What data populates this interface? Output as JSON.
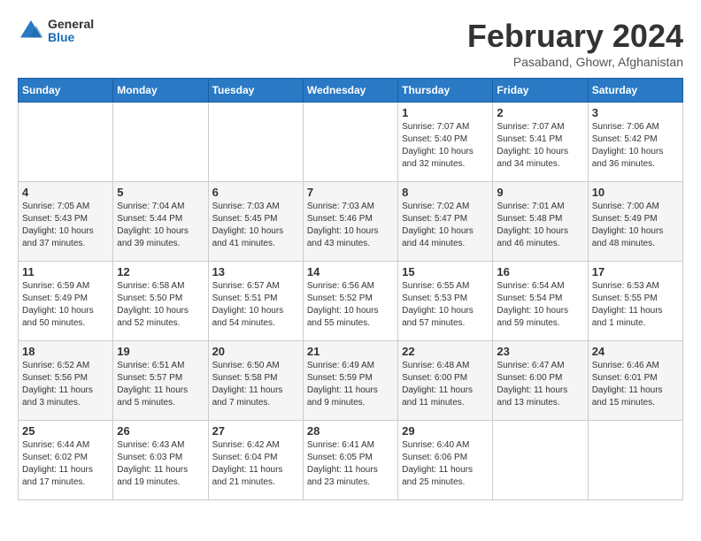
{
  "header": {
    "logo_general": "General",
    "logo_blue": "Blue",
    "month_year": "February 2024",
    "location": "Pasaband, Ghowr, Afghanistan"
  },
  "calendar": {
    "days_of_week": [
      "Sunday",
      "Monday",
      "Tuesday",
      "Wednesday",
      "Thursday",
      "Friday",
      "Saturday"
    ],
    "weeks": [
      [
        {
          "day": "",
          "info": ""
        },
        {
          "day": "",
          "info": ""
        },
        {
          "day": "",
          "info": ""
        },
        {
          "day": "",
          "info": ""
        },
        {
          "day": "1",
          "info": "Sunrise: 7:07 AM\nSunset: 5:40 PM\nDaylight: 10 hours\nand 32 minutes."
        },
        {
          "day": "2",
          "info": "Sunrise: 7:07 AM\nSunset: 5:41 PM\nDaylight: 10 hours\nand 34 minutes."
        },
        {
          "day": "3",
          "info": "Sunrise: 7:06 AM\nSunset: 5:42 PM\nDaylight: 10 hours\nand 36 minutes."
        }
      ],
      [
        {
          "day": "4",
          "info": "Sunrise: 7:05 AM\nSunset: 5:43 PM\nDaylight: 10 hours\nand 37 minutes."
        },
        {
          "day": "5",
          "info": "Sunrise: 7:04 AM\nSunset: 5:44 PM\nDaylight: 10 hours\nand 39 minutes."
        },
        {
          "day": "6",
          "info": "Sunrise: 7:03 AM\nSunset: 5:45 PM\nDaylight: 10 hours\nand 41 minutes."
        },
        {
          "day": "7",
          "info": "Sunrise: 7:03 AM\nSunset: 5:46 PM\nDaylight: 10 hours\nand 43 minutes."
        },
        {
          "day": "8",
          "info": "Sunrise: 7:02 AM\nSunset: 5:47 PM\nDaylight: 10 hours\nand 44 minutes."
        },
        {
          "day": "9",
          "info": "Sunrise: 7:01 AM\nSunset: 5:48 PM\nDaylight: 10 hours\nand 46 minutes."
        },
        {
          "day": "10",
          "info": "Sunrise: 7:00 AM\nSunset: 5:49 PM\nDaylight: 10 hours\nand 48 minutes."
        }
      ],
      [
        {
          "day": "11",
          "info": "Sunrise: 6:59 AM\nSunset: 5:49 PM\nDaylight: 10 hours\nand 50 minutes."
        },
        {
          "day": "12",
          "info": "Sunrise: 6:58 AM\nSunset: 5:50 PM\nDaylight: 10 hours\nand 52 minutes."
        },
        {
          "day": "13",
          "info": "Sunrise: 6:57 AM\nSunset: 5:51 PM\nDaylight: 10 hours\nand 54 minutes."
        },
        {
          "day": "14",
          "info": "Sunrise: 6:56 AM\nSunset: 5:52 PM\nDaylight: 10 hours\nand 55 minutes."
        },
        {
          "day": "15",
          "info": "Sunrise: 6:55 AM\nSunset: 5:53 PM\nDaylight: 10 hours\nand 57 minutes."
        },
        {
          "day": "16",
          "info": "Sunrise: 6:54 AM\nSunset: 5:54 PM\nDaylight: 10 hours\nand 59 minutes."
        },
        {
          "day": "17",
          "info": "Sunrise: 6:53 AM\nSunset: 5:55 PM\nDaylight: 11 hours\nand 1 minute."
        }
      ],
      [
        {
          "day": "18",
          "info": "Sunrise: 6:52 AM\nSunset: 5:56 PM\nDaylight: 11 hours\nand 3 minutes."
        },
        {
          "day": "19",
          "info": "Sunrise: 6:51 AM\nSunset: 5:57 PM\nDaylight: 11 hours\nand 5 minutes."
        },
        {
          "day": "20",
          "info": "Sunrise: 6:50 AM\nSunset: 5:58 PM\nDaylight: 11 hours\nand 7 minutes."
        },
        {
          "day": "21",
          "info": "Sunrise: 6:49 AM\nSunset: 5:59 PM\nDaylight: 11 hours\nand 9 minutes."
        },
        {
          "day": "22",
          "info": "Sunrise: 6:48 AM\nSunset: 6:00 PM\nDaylight: 11 hours\nand 11 minutes."
        },
        {
          "day": "23",
          "info": "Sunrise: 6:47 AM\nSunset: 6:00 PM\nDaylight: 11 hours\nand 13 minutes."
        },
        {
          "day": "24",
          "info": "Sunrise: 6:46 AM\nSunset: 6:01 PM\nDaylight: 11 hours\nand 15 minutes."
        }
      ],
      [
        {
          "day": "25",
          "info": "Sunrise: 6:44 AM\nSunset: 6:02 PM\nDaylight: 11 hours\nand 17 minutes."
        },
        {
          "day": "26",
          "info": "Sunrise: 6:43 AM\nSunset: 6:03 PM\nDaylight: 11 hours\nand 19 minutes."
        },
        {
          "day": "27",
          "info": "Sunrise: 6:42 AM\nSunset: 6:04 PM\nDaylight: 11 hours\nand 21 minutes."
        },
        {
          "day": "28",
          "info": "Sunrise: 6:41 AM\nSunset: 6:05 PM\nDaylight: 11 hours\nand 23 minutes."
        },
        {
          "day": "29",
          "info": "Sunrise: 6:40 AM\nSunset: 6:06 PM\nDaylight: 11 hours\nand 25 minutes."
        },
        {
          "day": "",
          "info": ""
        },
        {
          "day": "",
          "info": ""
        }
      ]
    ]
  }
}
